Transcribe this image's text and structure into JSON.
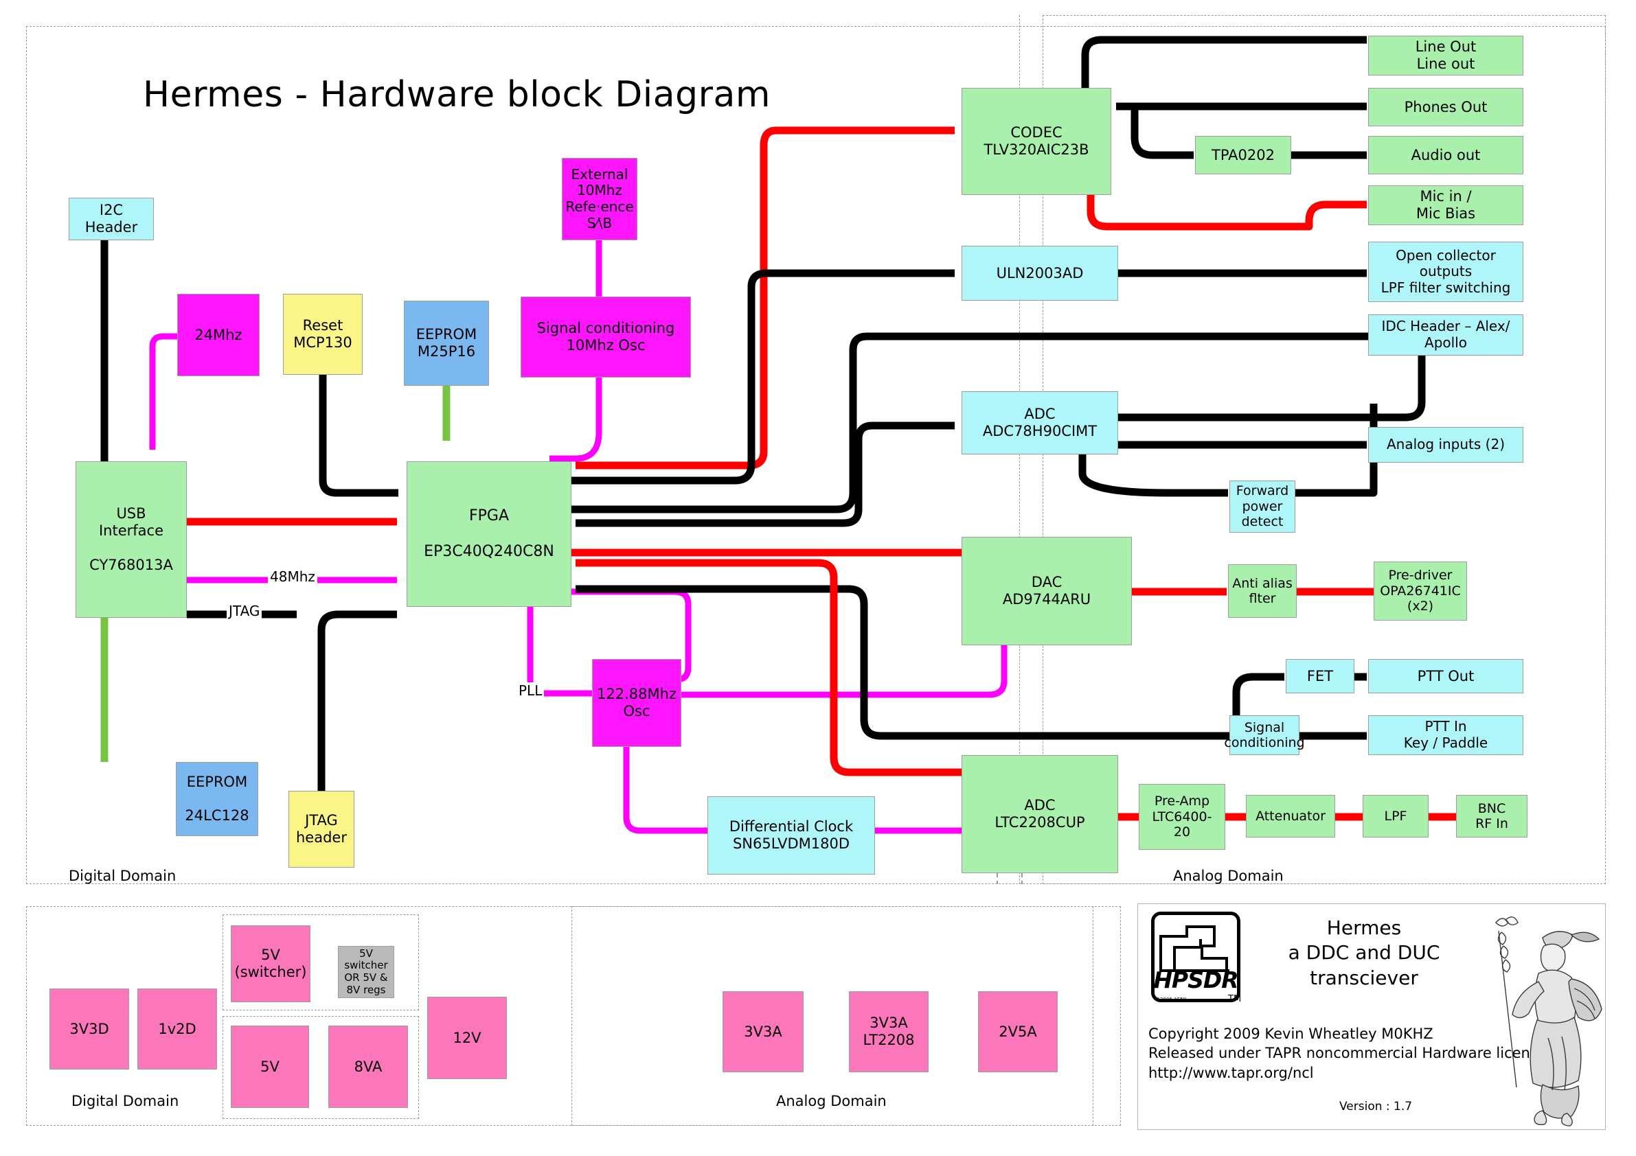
{
  "title": "Hermes - Hardware block Diagram",
  "domains": {
    "digital_label": "Digital Domain",
    "analog_label": "Analog Domain",
    "psu_digital_label": "Digital Domain",
    "psu_analog_label": "Analog Domain"
  },
  "colors": {
    "green": "#a9f0ac",
    "cyan": "#aff6fb",
    "magenta": "#fd16fd",
    "yellow": "#fbf587",
    "blue": "#7bb8f0",
    "pink": "#fb76bb",
    "grey": "#b9b9b9",
    "wire_black": "#000000",
    "wire_red": "#ff0000",
    "wire_magenta": "#ff00ff",
    "wire_green": "#76c442"
  },
  "blocks": {
    "i2c_header": "I2C\nHeader",
    "osc_24mhz": "24Mhz",
    "reset": "Reset\nMCP130",
    "eeprom_m25p16": "EEPROM\nM25P16",
    "ext_ref": "External\n10Mhz\nRefe·ence\nS⁄\\B",
    "signal_cond_10mhz": "Signal conditioning\n10Mhz Osc",
    "usb_interface": "USB\nInterface\n\nCY768013A",
    "fpga": "FPGA\n\nEP3C40Q240C8N",
    "eeprom_24lc128": "EEPROM\n\n24LC128",
    "jtag_header": "JTAG\nheader",
    "osc_122": "122.88Mhz\nOsc",
    "diff_clock": "Differential Clock\nSN65LVDM180D",
    "codec": "CODEC\nTLV320AIC23B",
    "tpa0202": "TPA0202",
    "line_out": "Line Out\nLine out",
    "phones_out": "Phones Out",
    "audio_out": "Audio out",
    "mic_in": "Mic in /\nMic Bias",
    "uln2003ad": "ULN2003AD",
    "open_collector": "Open collector\noutputs\nLPF filter switching",
    "idc_header": "IDC Header – Alex/\nApollo",
    "adc78h90": "ADC\nADC78H90CIMT",
    "analog_inputs": "Analog inputs (2)",
    "fwd_power": "Forward\npower\ndetect",
    "dac": "DAC\nAD9744ARU",
    "anti_alias": "Anti alias\nflter",
    "pre_driver": "Pre-driver\nOPA26741IC\n(x2)",
    "fet": "FET",
    "ptt_out": "PTT Out",
    "signal_cond_ptt": "Signal\nconditioning",
    "ptt_in": "PTT In\nKey / Paddle",
    "adc_ltc2208": "ADC\nLTC2208CUP",
    "pre_amp": "Pre-Amp\nLTC6400-\n20",
    "attenuator": "Attenuator",
    "lpf": "LPF",
    "bnc_rf_in": "BNC\nRF In"
  },
  "wire_labels": {
    "mhz48": "48Mhz",
    "jtag": "JTAG",
    "pll": "PLL"
  },
  "power": {
    "digital": [
      {
        "id": "3v3d",
        "label": "3V3D"
      },
      {
        "id": "1v2d",
        "label": "1v2D"
      },
      {
        "id": "5v_switcher",
        "label": "5V\n(switcher)"
      },
      {
        "id": "note_switcher",
        "label": "5V\nswitcher\nOR 5V &\n8V regs"
      },
      {
        "id": "5v",
        "label": "5V"
      },
      {
        "id": "8va",
        "label": "8VA"
      },
      {
        "id": "12v",
        "label": "12V"
      }
    ],
    "analog": [
      {
        "id": "3v3a",
        "label": "3V3A"
      },
      {
        "id": "3v3a_lt2208",
        "label": "3V3A\nLT2208"
      },
      {
        "id": "2v5a",
        "label": "2V5A"
      }
    ]
  },
  "credit": {
    "logo_word": "HPSDR",
    "logo_tiny": "©2006 AE5K",
    "logo_tm": "TM",
    "heading": "Hermes\na DDC and DUC\ntransciever",
    "body": "Copyright 2009 Kevin Wheatley M0KHZ\nReleased under TAPR noncommercial Hardware licence\nhttp://www.tapr.org/ncl",
    "version": "Version : 1.7"
  }
}
